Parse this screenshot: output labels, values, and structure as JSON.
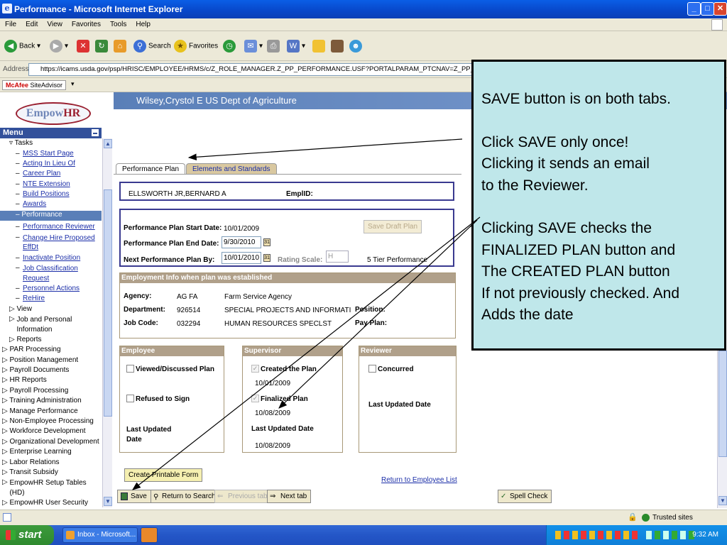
{
  "window": {
    "title": "Performance - Microsoft Internet Explorer"
  },
  "menubar": [
    "File",
    "Edit",
    "View",
    "Favorites",
    "Tools",
    "Help"
  ],
  "toolbar": {
    "back": "Back",
    "search": "Search",
    "favorites": "Favorites"
  },
  "address": {
    "label": "Address",
    "url": "https://icams.usda.gov/psp/HRISC/EMPLOYEE/HRMS/c/Z_ROLE_MANAGER.Z_PP_PERFORMANCE.USF?PORTALPARAM_PTCNAV=Z_PP_PERFORMANCE_USF"
  },
  "mcafee": {
    "brand": "McAfee",
    "label": "SiteAdvisor"
  },
  "header": {
    "logo_a": "Empow",
    "logo_b": "HR",
    "banner": "Wilsey,Crystol E  US Dept of Agriculture"
  },
  "menu": {
    "title": "Menu",
    "tasks_label": "Tasks",
    "task_links": [
      "MSS Start Page",
      "Acting In Lieu Of",
      "Career Plan",
      "NTE Extension",
      "Build Positions",
      "Awards",
      "Performance",
      "Performance Reviewer",
      "Change Hire Proposed EffDt",
      "Inactivate Position",
      "Job Classification Request",
      "Personnel Actions",
      "ReHire"
    ],
    "sub_groups": [
      "View",
      "Job and Personal Information",
      "Reports"
    ],
    "top_groups": [
      "PAR Processing",
      "Position Management",
      "Payroll Documents",
      "HR Reports",
      "Payroll Processing",
      "Training Administration",
      "Manage Performance",
      "Non-Employee Processing",
      "Workforce Development",
      "Organizational Development",
      "Enterprise Learning",
      "Labor Relations",
      "Transit Subsidy",
      "EmpowHR Setup Tables (HD)",
      "EmpowHR User Security"
    ]
  },
  "tabs": {
    "active": "Performance Plan",
    "other": "Elements and Standards"
  },
  "employee": {
    "name": "ELLSWORTH JR,BERNARD A",
    "emplid_label": "EmplID:"
  },
  "plan": {
    "start_label": "Performance Plan Start Date:",
    "start_value": "10/01/2009",
    "end_label": "Performance Plan End Date:",
    "end_value": "9/30/2010",
    "next_label": "Next Performance Plan By:",
    "next_value": "10/01/2010",
    "rating_label": "Rating Scale:",
    "rating_value": "H",
    "rating_desc": "5 Tier Performance",
    "save_draft": "Save Draft Plan"
  },
  "employment": {
    "header": "Employment Info when plan was established",
    "agency_label": "Agency:",
    "agency_code": "AG   FA",
    "agency_name": "Farm Service Agency",
    "dept_label": "Department:",
    "dept_code": "926514",
    "dept_name": "SPECIAL PROJECTS AND INFORMATI",
    "job_label": "Job Code:",
    "job_code": "032294",
    "job_name": "HUMAN RESOURCES SPECLST",
    "position_label": "Position:",
    "paryplan_label": "Pay Plan:"
  },
  "employee_box": {
    "header": "Employee",
    "viewed": "Viewed/Discussed Plan",
    "refused": "Refused to Sign",
    "last_updated": "Last Updated Date"
  },
  "supervisor_box": {
    "header": "Supervisor",
    "created": "Created the Plan",
    "created_date": "10/01/2009",
    "finalized": "Finalized Plan",
    "finalized_date": "10/08/2009",
    "last_updated": "Last Updated Date",
    "last_updated_date": "10/08/2009"
  },
  "reviewer_box": {
    "header": "Reviewer",
    "concurred": "Concurred",
    "last_updated": "Last Updated Date"
  },
  "buttons": {
    "printable": "Create Printable Form",
    "return_list": "Return to Employee List",
    "save": "Save",
    "return_search": "Return to Search",
    "prev_tab": "Previous tab",
    "next_tab": "Next tab",
    "spell": "Spell Check"
  },
  "callout": {
    "line1": "SAVE button is on both tabs.",
    "line2": "Click SAVE only once!",
    "line3": "Clicking it sends an email",
    "line4": "to the Reviewer.",
    "line5": "Clicking SAVE checks the",
    "line6": "FINALIZED PLAN button and",
    "line7": "The CREATED PLAN button",
    "line8": "If not previously checked. And",
    "line9": "Adds the date"
  },
  "status": {
    "zone": "Trusted sites"
  },
  "taskbar": {
    "start": "start",
    "task1": "Inbox - Microsoft...",
    "clock": "9:32 AM"
  },
  "colors": {
    "xp_blue": "#0a5ee6",
    "callout_bg": "#bfe7ea",
    "banner": "#5a7fb8",
    "section_header": "#b0a08a"
  }
}
